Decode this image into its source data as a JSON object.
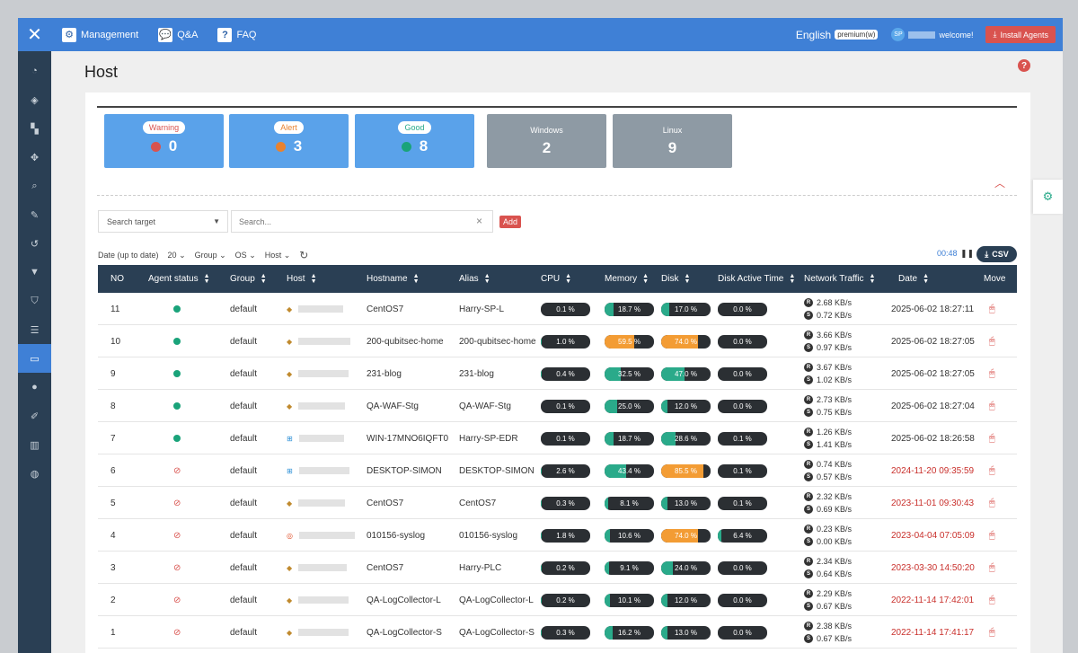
{
  "topbar": {
    "menu": [
      {
        "label": "Management",
        "icon": "gear-icon",
        "glyph": "⚙"
      },
      {
        "label": "Q&A",
        "icon": "chat-icon",
        "glyph": "💬"
      },
      {
        "label": "FAQ",
        "icon": "question-icon",
        "glyph": "?"
      }
    ],
    "language": "English",
    "plan_badge": "premium(w)",
    "user_initials": "SP",
    "welcome": "welcome!",
    "install_button": "Install Agents"
  },
  "sidebar": {
    "items": [
      {
        "icon": "dashboard-icon",
        "glyph": "◔"
      },
      {
        "icon": "layers-icon",
        "glyph": "◈"
      },
      {
        "icon": "widget-icon",
        "glyph": "▚"
      },
      {
        "icon": "move-icon",
        "glyph": "✥"
      },
      {
        "icon": "search-icon",
        "glyph": "⌕"
      },
      {
        "icon": "magic-wand-icon",
        "glyph": "✎"
      },
      {
        "icon": "history-icon",
        "glyph": "↺"
      },
      {
        "icon": "filter-icon",
        "glyph": "▼"
      },
      {
        "icon": "shield-icon",
        "glyph": "⛉"
      },
      {
        "icon": "server-icon",
        "glyph": "☰"
      },
      {
        "icon": "monitor-icon",
        "glyph": "▭",
        "active": true
      },
      {
        "icon": "alert-icon",
        "glyph": "●"
      },
      {
        "icon": "edit-icon",
        "glyph": "✐"
      },
      {
        "icon": "bar-chart-icon",
        "glyph": "▥"
      },
      {
        "icon": "globe-icon",
        "glyph": "◍"
      }
    ]
  },
  "page": {
    "title": "Host"
  },
  "summary": {
    "warning": {
      "label": "Warning",
      "value": "0",
      "color": "#d9534f"
    },
    "alert": {
      "label": "Alert",
      "value": "3",
      "color": "#e8822f"
    },
    "good": {
      "label": "Good",
      "value": "8",
      "color": "#1aa37a"
    },
    "windows": {
      "label": "Windows",
      "value": "2"
    },
    "linux": {
      "label": "Linux",
      "value": "9"
    }
  },
  "search": {
    "target_label": "Search target",
    "placeholder": "Search...",
    "add_label": "Add"
  },
  "filters": {
    "date": "Date (up to date)",
    "page_size": "20",
    "group": "Group",
    "os": "OS",
    "host": "Host"
  },
  "refresh_timer": "00:48",
  "csv_label": "CSV",
  "table": {
    "columns": [
      "NO",
      "Agent status",
      "Group",
      "Host",
      "Hostname",
      "Alias",
      "CPU",
      "Memory",
      "Disk",
      "Disk Active Time",
      "Network Traffic",
      "Date",
      "Move"
    ],
    "rows": [
      {
        "no": "11",
        "status": "online",
        "group": "default",
        "os": "linux",
        "hostname": "CentOS7",
        "alias": "Harry-SP-L",
        "cpu": "0.1 %",
        "cpu_pct": 0.1,
        "memory": "18.7 %",
        "mem_pct": 18.7,
        "disk": "17.0 %",
        "disk_pct": 17.0,
        "disk_active": "0.0 %",
        "dat_pct": 0.0,
        "net_r": "2.68 KB/s",
        "net_s": "0.72 KB/s",
        "date": "2025-06-02 18:27:11",
        "date_old": false
      },
      {
        "no": "10",
        "status": "online",
        "group": "default",
        "os": "linux",
        "hostname": "200-qubitsec-home",
        "alias": "200-qubitsec-home",
        "cpu": "1.0 %",
        "cpu_pct": 1.0,
        "memory": "59.5 %",
        "mem_pct": 59.5,
        "disk": "74.0 %",
        "disk_pct": 74.0,
        "disk_active": "0.0 %",
        "dat_pct": 0.0,
        "net_r": "3.66 KB/s",
        "net_s": "0.97 KB/s",
        "date": "2025-06-02 18:27:05",
        "date_old": false
      },
      {
        "no": "9",
        "status": "online",
        "group": "default",
        "os": "linux",
        "hostname": "231-blog",
        "alias": "231-blog",
        "cpu": "0.4 %",
        "cpu_pct": 0.4,
        "memory": "32.5 %",
        "mem_pct": 32.5,
        "disk": "47.0 %",
        "disk_pct": 47.0,
        "disk_active": "0.0 %",
        "dat_pct": 0.0,
        "net_r": "3.67 KB/s",
        "net_s": "1.02 KB/s",
        "date": "2025-06-02 18:27:05",
        "date_old": false
      },
      {
        "no": "8",
        "status": "online",
        "group": "default",
        "os": "linux",
        "hostname": "QA-WAF-Stg",
        "alias": "QA-WAF-Stg",
        "cpu": "0.1 %",
        "cpu_pct": 0.1,
        "memory": "25.0 %",
        "mem_pct": 25.0,
        "disk": "12.0 %",
        "disk_pct": 12.0,
        "disk_active": "0.0 %",
        "dat_pct": 0.0,
        "net_r": "2.73 KB/s",
        "net_s": "0.75 KB/s",
        "date": "2025-06-02 18:27:04",
        "date_old": false
      },
      {
        "no": "7",
        "status": "online",
        "group": "default",
        "os": "windows",
        "hostname": "WIN-17MNO6IQFT0",
        "alias": "Harry-SP-EDR",
        "cpu": "0.1 %",
        "cpu_pct": 0.1,
        "memory": "18.7 %",
        "mem_pct": 18.7,
        "disk": "28.6 %",
        "disk_pct": 28.6,
        "disk_active": "0.1 %",
        "dat_pct": 0.1,
        "net_r": "1.26 KB/s",
        "net_s": "1.41 KB/s",
        "date": "2025-06-02 18:26:58",
        "date_old": false
      },
      {
        "no": "6",
        "status": "offline",
        "group": "default",
        "os": "windows",
        "hostname": "DESKTOP-SIMON",
        "alias": "DESKTOP-SIMON",
        "cpu": "2.6 %",
        "cpu_pct": 2.6,
        "memory": "43.4 %",
        "mem_pct": 43.4,
        "disk": "85.5 %",
        "disk_pct": 85.5,
        "disk_active": "0.1 %",
        "dat_pct": 0.1,
        "net_r": "0.74 KB/s",
        "net_s": "0.57 KB/s",
        "date": "2024-11-20 09:35:59",
        "date_old": true
      },
      {
        "no": "5",
        "status": "offline",
        "group": "default",
        "os": "linux",
        "hostname": "CentOS7",
        "alias": "CentOS7",
        "cpu": "0.3 %",
        "cpu_pct": 0.3,
        "memory": "8.1 %",
        "mem_pct": 8.1,
        "disk": "13.0 %",
        "disk_pct": 13.0,
        "disk_active": "0.1 %",
        "dat_pct": 0.1,
        "net_r": "2.32 KB/s",
        "net_s": "0.69 KB/s",
        "date": "2023-11-01 09:30:43",
        "date_old": true
      },
      {
        "no": "4",
        "status": "offline",
        "group": "default",
        "os": "ubuntu",
        "hostname": "010156-syslog",
        "alias": "010156-syslog",
        "cpu": "1.8 %",
        "cpu_pct": 1.8,
        "memory": "10.6 %",
        "mem_pct": 10.6,
        "disk": "74.0 %",
        "disk_pct": 74.0,
        "disk_active": "6.4 %",
        "dat_pct": 6.4,
        "net_r": "0.23 KB/s",
        "net_s": "0.00 KB/s",
        "date": "2023-04-04 07:05:09",
        "date_old": true
      },
      {
        "no": "3",
        "status": "offline",
        "group": "default",
        "os": "linux",
        "hostname": "CentOS7",
        "alias": "Harry-PLC",
        "cpu": "0.2 %",
        "cpu_pct": 0.2,
        "memory": "9.1 %",
        "mem_pct": 9.1,
        "disk": "24.0 %",
        "disk_pct": 24.0,
        "disk_active": "0.0 %",
        "dat_pct": 0.0,
        "net_r": "2.34 KB/s",
        "net_s": "0.64 KB/s",
        "date": "2023-03-30 14:50:20",
        "date_old": true
      },
      {
        "no": "2",
        "status": "offline",
        "group": "default",
        "os": "linux",
        "hostname": "QA-LogCollector-L",
        "alias": "QA-LogCollector-L",
        "cpu": "0.2 %",
        "cpu_pct": 0.2,
        "memory": "10.1 %",
        "mem_pct": 10.1,
        "disk": "12.0 %",
        "disk_pct": 12.0,
        "disk_active": "0.0 %",
        "dat_pct": 0.0,
        "net_r": "2.29 KB/s",
        "net_s": "0.67 KB/s",
        "date": "2022-11-14 17:42:01",
        "date_old": true
      },
      {
        "no": "1",
        "status": "offline",
        "group": "default",
        "os": "linux",
        "hostname": "QA-LogCollector-S",
        "alias": "QA-LogCollector-S",
        "cpu": "0.3 %",
        "cpu_pct": 0.3,
        "memory": "16.2 %",
        "mem_pct": 16.2,
        "disk": "13.0 %",
        "disk_pct": 13.0,
        "disk_active": "0.0 %",
        "dat_pct": 0.0,
        "net_r": "2.38 KB/s",
        "net_s": "0.67 KB/s",
        "date": "2022-11-14 17:41:17",
        "date_old": true
      }
    ]
  },
  "colors": {
    "teal": "#2aaa8a",
    "orange": "#f39c34",
    "dark_bar": "#2b2f33"
  }
}
